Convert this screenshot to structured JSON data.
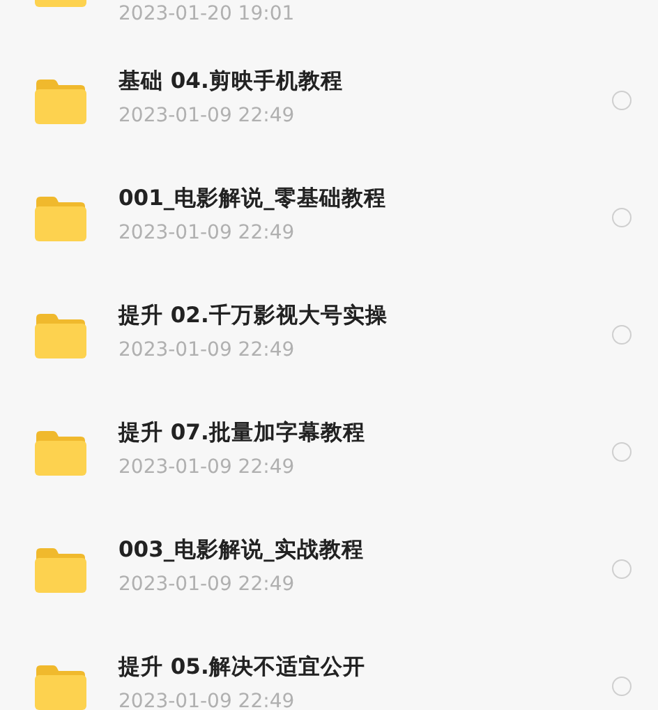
{
  "files": [
    {
      "date": "2023-01-20 19:01"
    },
    {
      "title": "基础 04.剪映手机教程",
      "date": "2023-01-09 22:49",
      "selected": false
    },
    {
      "title": "001_电影解说_零基础教程",
      "date": "2023-01-09 22:49",
      "selected": false
    },
    {
      "title": "提升 02.千万影视大号实操",
      "date": "2023-01-09 22:49",
      "selected": false
    },
    {
      "title": "提升 07.批量加字幕教程",
      "date": "2023-01-09 22:49",
      "selected": false
    },
    {
      "title": "003_电影解说_实战教程",
      "date": "2023-01-09 22:49",
      "selected": false
    },
    {
      "title": "提升 05.解决不适宜公开",
      "date": "2023-01-09 22:49",
      "selected": false
    }
  ]
}
